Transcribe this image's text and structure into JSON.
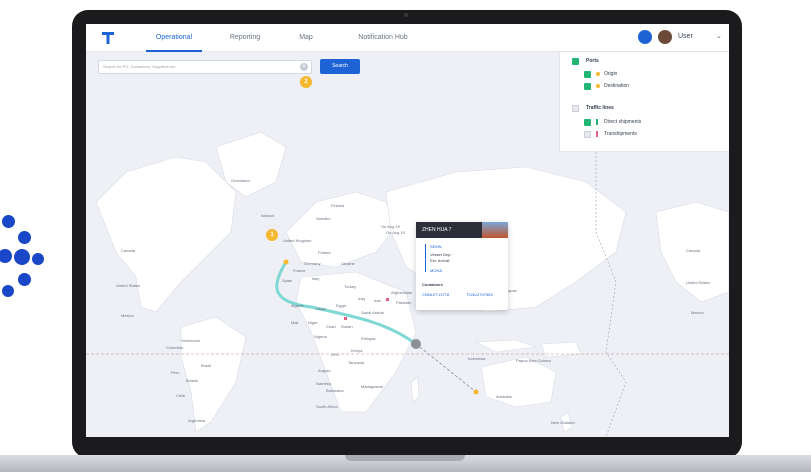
{
  "nav": {
    "tabs": [
      {
        "label": "Operational",
        "active": true
      },
      {
        "label": "Reporting",
        "active": false
      },
      {
        "label": "Map",
        "active": false
      },
      {
        "label": "Notification Hub",
        "active": false
      }
    ],
    "user_label": "User"
  },
  "search": {
    "placeholder": "Search for PO, Containers, Suppliers etc",
    "button_label": "Search",
    "step_badge": "2"
  },
  "step_badge_map": "1",
  "legend": {
    "ports_title": "Ports",
    "origin_label": "Origin",
    "destination_label": "Destination",
    "traffic_title": "Traffic lines",
    "direct_label": "Direct shipments",
    "trans_label": "Transhipments"
  },
  "map_labels": {
    "greenland": "Greenland",
    "iceland": "Iceland",
    "sweden": "Sweden",
    "finland": "Finland",
    "uk": "United Kingdom",
    "poland": "Poland",
    "germany": "Germany",
    "ukraine": "Ukraine",
    "france": "France",
    "spain": "Spain",
    "italy": "Italy",
    "turkey": "Turkey",
    "kazakhstan": "Kazakhstan",
    "iraq": "Iraq",
    "iran": "Iran",
    "afghanistan": "Afghanistan",
    "pakistan": "Pakistan",
    "algeria": "Algeria",
    "libya": "Libya",
    "egypt": "Egypt",
    "saudi": "Saudi Arabia",
    "mali": "Mali",
    "niger": "Niger",
    "chad": "Chad",
    "sudan": "Sudan",
    "ethiopia": "Ethiopia",
    "nigeria": "Nigeria",
    "kenya": "Kenya",
    "drc": "DRC",
    "tanzania": "Tanzania",
    "angola": "Angola",
    "namibia": "Namibia",
    "botswana": "Botswana",
    "madagascar": "Madagascar",
    "south_africa": "South Africa",
    "canada": "Canada",
    "us": "United States",
    "mexico": "Mexico",
    "venezuela": "Venezuela",
    "colombia": "Colombia",
    "peru": "Peru",
    "brazil": "Brazil",
    "bolivia": "Bolivia",
    "chile": "Chile",
    "argentina": "Argentina",
    "japan": "Japan",
    "indonesia": "Indonesia",
    "png": "Papua New Guinea",
    "australia": "Australia",
    "nz": "New Zealand",
    "canada_r": "Canada",
    "us_r": "United States",
    "mexico_r": "Mexico",
    "aug1": "On Aug 19",
    "aug2": "On Aug 19"
  },
  "popup": {
    "vessel": "ZHEN HUA 7",
    "eta_label": "SEMN",
    "vessel_line1": "Vessel Dep.:",
    "vessel_line2": "Est. Arrival:",
    "dest_code": "MOHA",
    "containers_label": "Containers",
    "container_a": "CNNLET13778",
    "container_b": "TCNU2797983"
  },
  "colors": {
    "accent": "#1e63d6",
    "route": "#7fd8d4",
    "badge": "#f5b82e",
    "green": "#22b573",
    "brand_dots": "#1a47c8"
  }
}
